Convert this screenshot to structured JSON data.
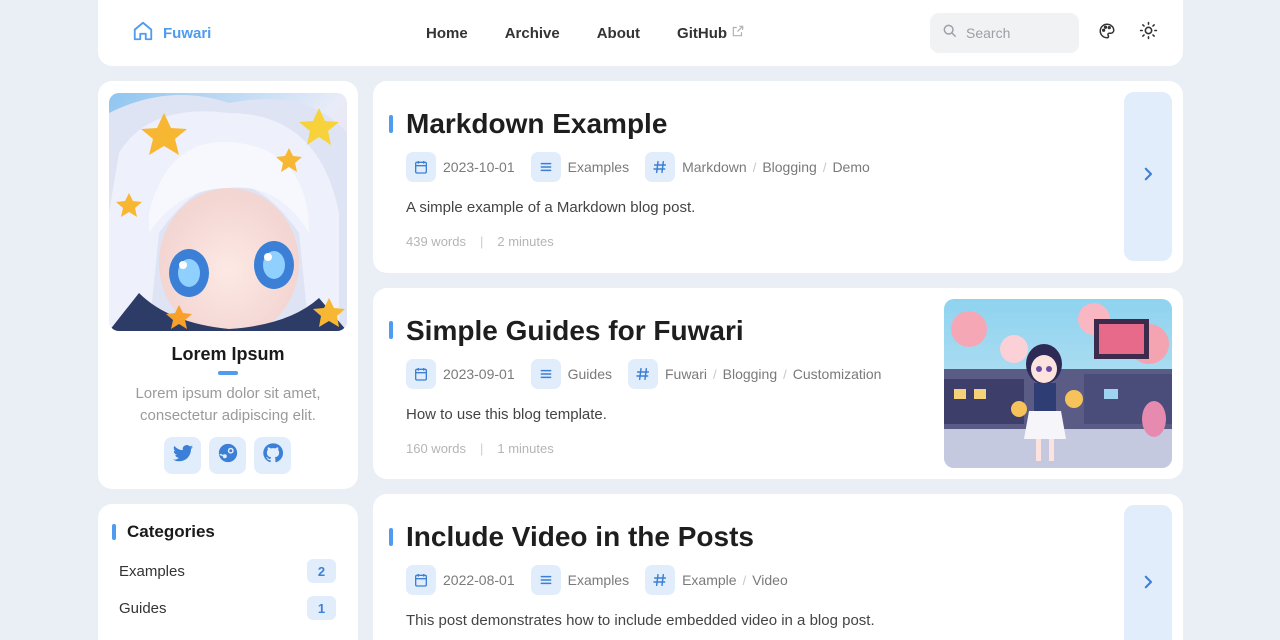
{
  "navbar": {
    "brand": "Fuwari",
    "links": [
      {
        "label": "Home"
      },
      {
        "label": "Archive"
      },
      {
        "label": "About"
      },
      {
        "label": "GitHub"
      }
    ],
    "search_placeholder": "Search",
    "icons": [
      "home-icon",
      "external-link-icon",
      "search-icon",
      "palette-icon",
      "sun-icon"
    ]
  },
  "profile": {
    "name": "Lorem Ipsum",
    "bio": "Lorem ipsum dolor sit amet, consectetur adipiscing elit.",
    "socials": [
      "twitter-icon",
      "steam-icon",
      "github-icon"
    ]
  },
  "categories": {
    "title": "Categories",
    "items": [
      {
        "label": "Examples",
        "count": "2"
      },
      {
        "label": "Guides",
        "count": "1"
      }
    ]
  },
  "posts": [
    {
      "title": "Markdown Example",
      "date": "2023-10-01",
      "category": "Examples",
      "tags": [
        "Markdown",
        "Blogging",
        "Demo"
      ],
      "description": "A simple example of a Markdown blog post.",
      "words": "439 words",
      "time": "2 minutes"
    },
    {
      "title": "Simple Guides for Fuwari",
      "date": "2023-09-01",
      "category": "Guides",
      "tags": [
        "Fuwari",
        "Blogging",
        "Customization"
      ],
      "description": "How to use this blog template.",
      "words": "160 words",
      "time": "1 minutes"
    },
    {
      "title": "Include Video in the Posts",
      "date": "2022-08-01",
      "category": "Examples",
      "tags": [
        "Example",
        "Video"
      ],
      "description": "This post demonstrates how to include embedded video in a blog post."
    }
  ],
  "colors": {
    "accent": "#4f9bef",
    "background": "#eaeef5",
    "chip": "#e2edfc"
  }
}
